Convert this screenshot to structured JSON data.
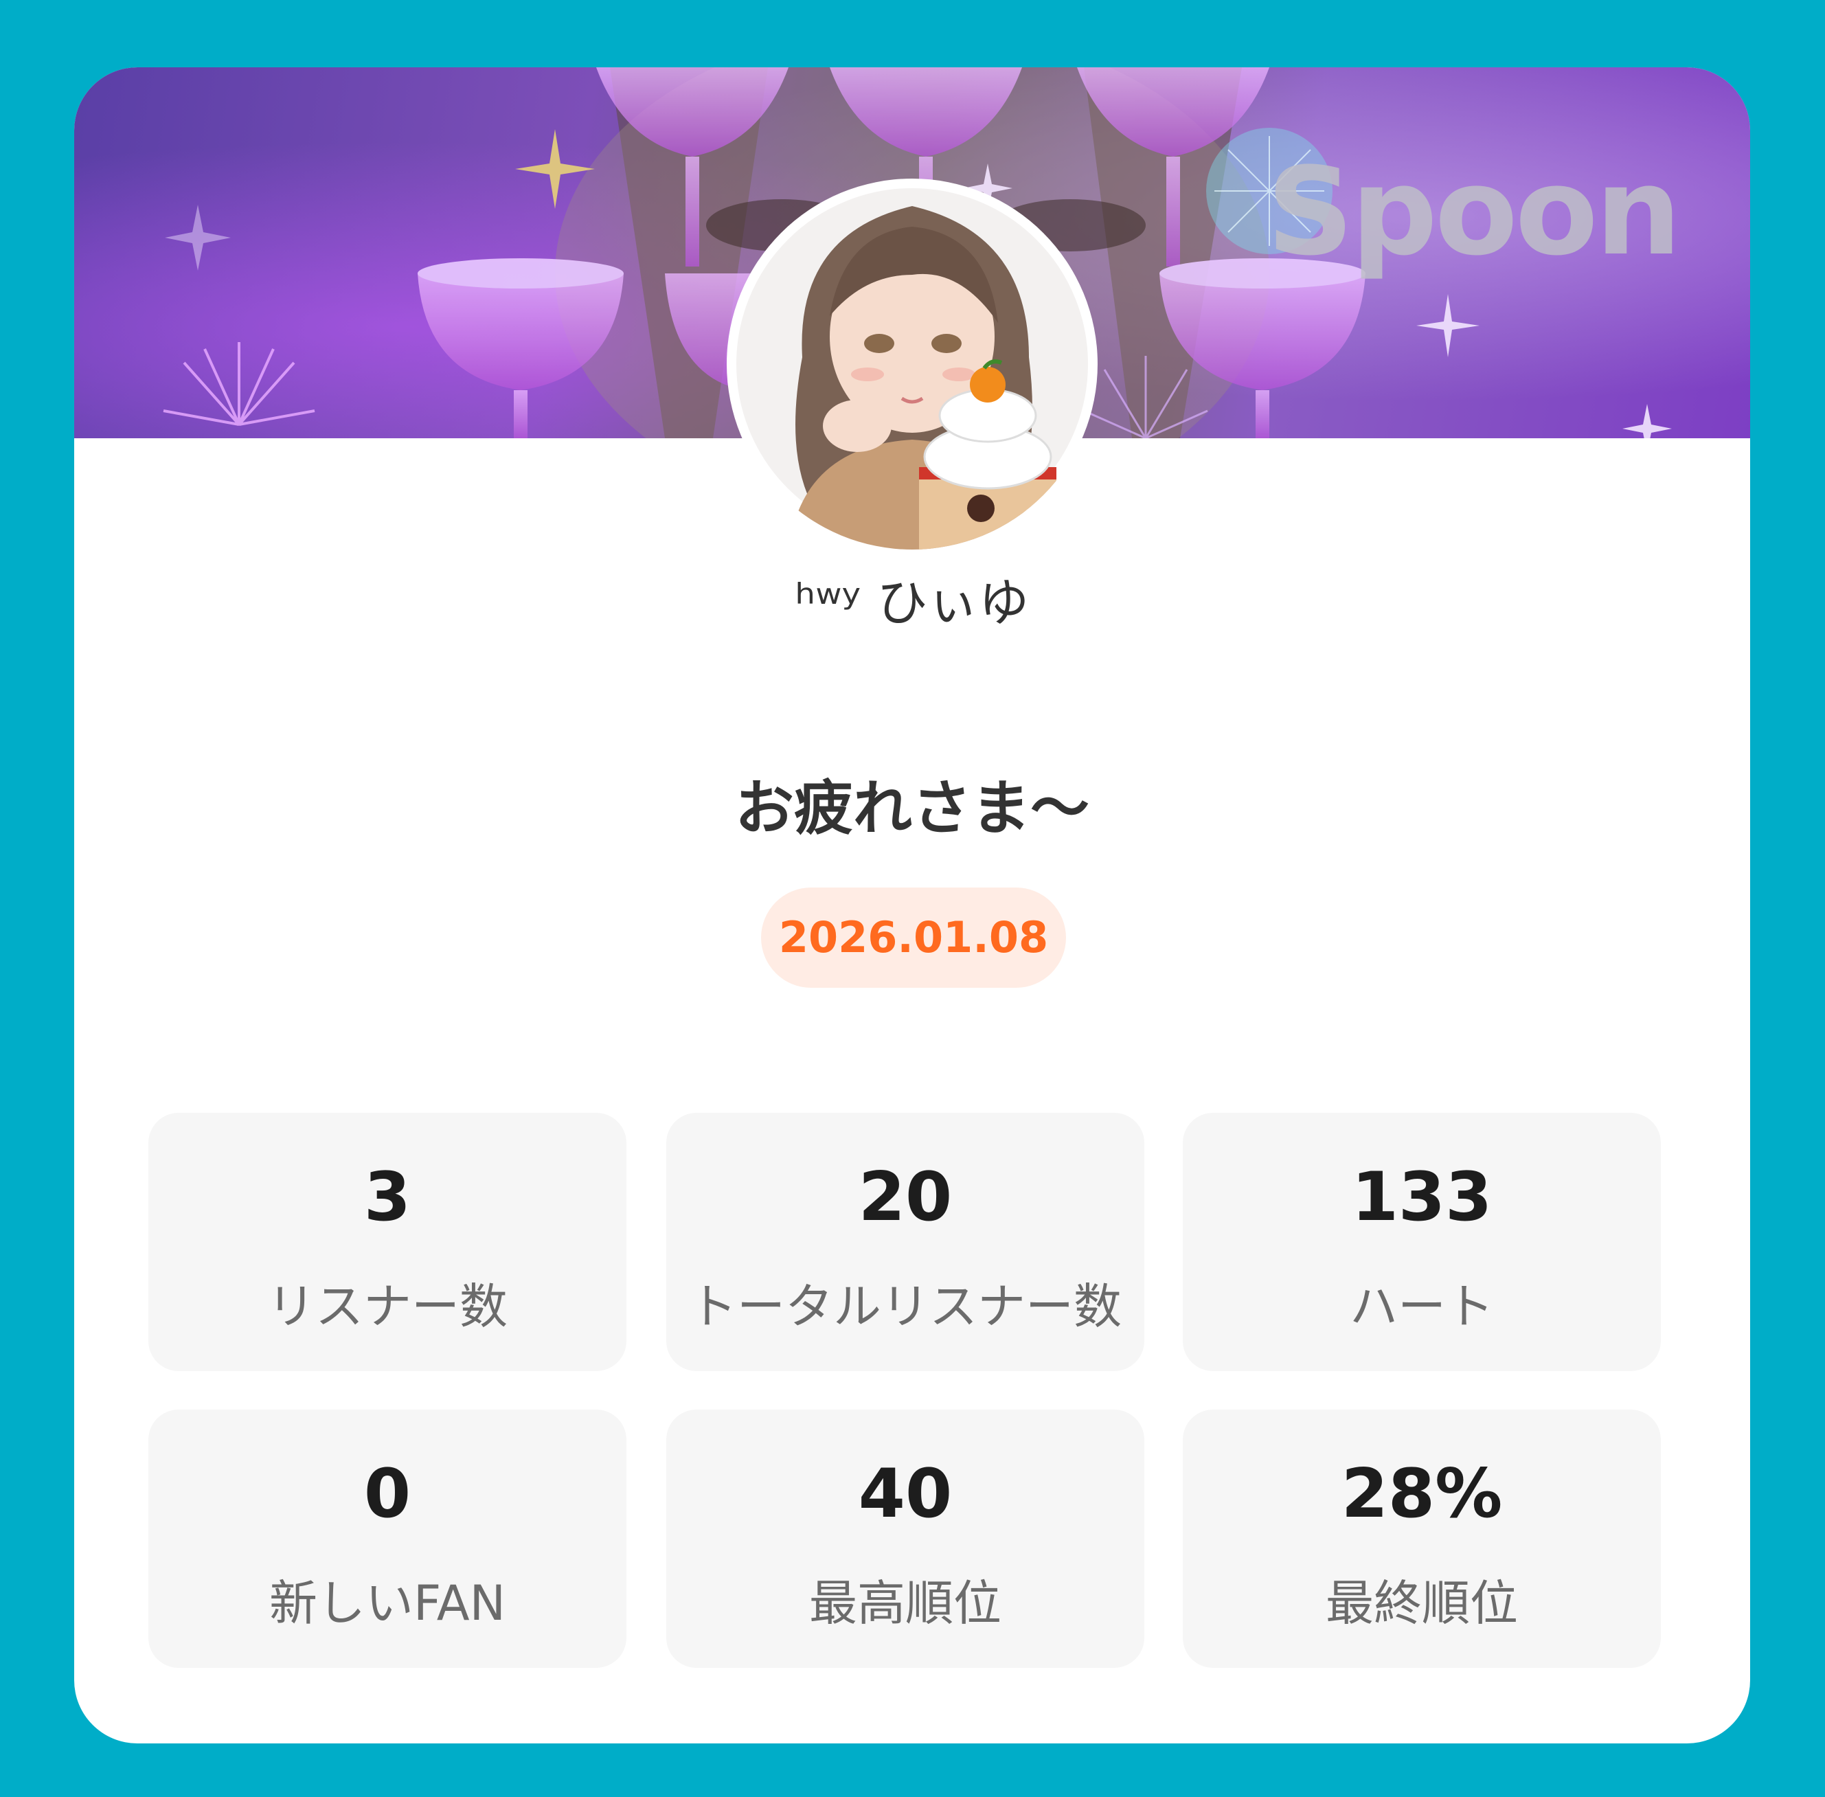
{
  "banner": {
    "brand": "Spoon"
  },
  "profile": {
    "username": "ʰʷʸ ひぃゆ"
  },
  "post": {
    "title": "お疲れさま～",
    "date": "2026.01.08"
  },
  "stats": [
    {
      "value": "3",
      "label": "リスナー数"
    },
    {
      "value": "20",
      "label": "トータルリスナー数"
    },
    {
      "value": "133",
      "label": "ハート"
    },
    {
      "value": "0",
      "label": "新しいFAN"
    },
    {
      "value": "40",
      "label": "最高順位"
    },
    {
      "value": "28%",
      "label": "最終順位"
    }
  ],
  "colors": {
    "page_background": "#00adc8",
    "card": "#ffffff",
    "date_text": "#ff6a1f",
    "date_pill": "#ffece4",
    "stat_tile": "#f6f6f6"
  }
}
